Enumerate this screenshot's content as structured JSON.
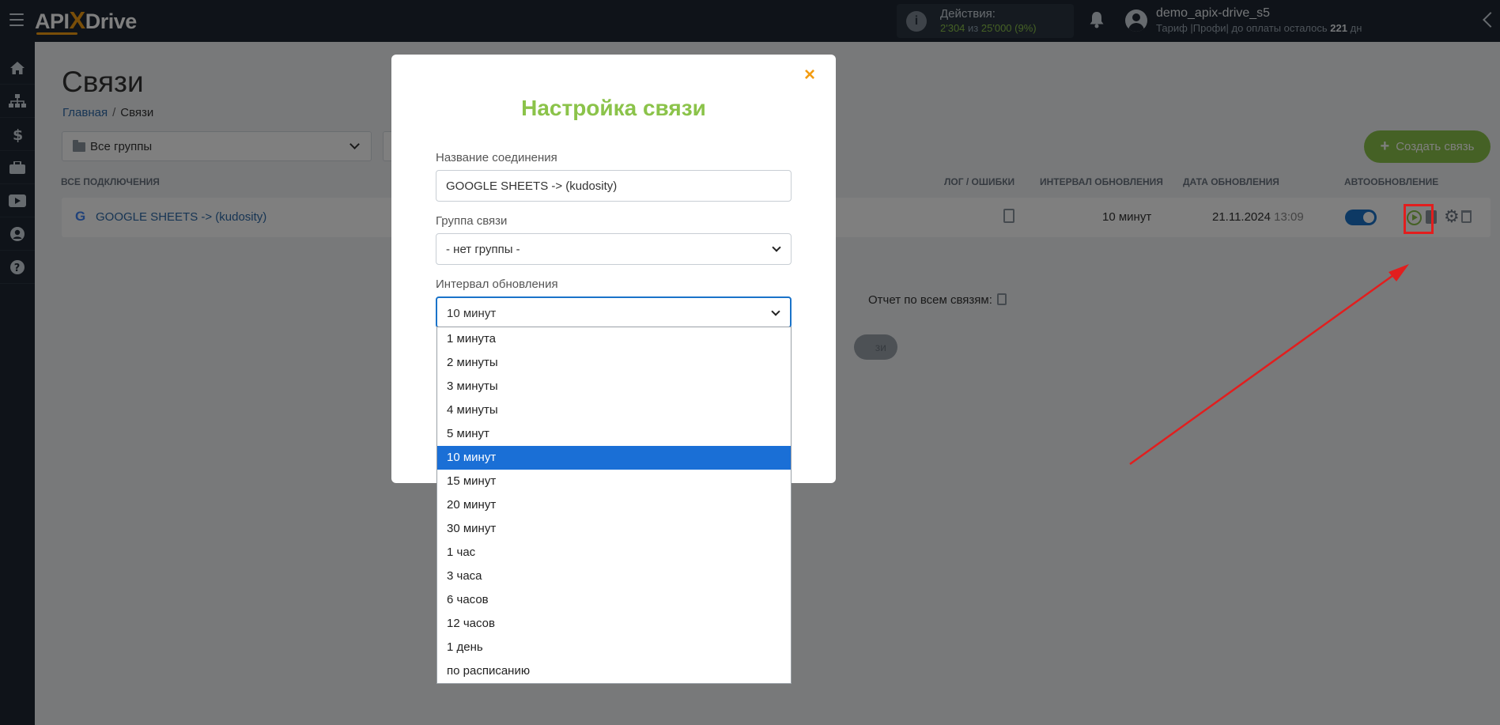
{
  "topbar": {
    "logo_prefix": "API",
    "logo_x": "X",
    "logo_suffix": "Drive",
    "actions_label": "Действия:",
    "actions_used": "2'304",
    "actions_of": "из",
    "actions_total": "25'000",
    "actions_percent": "(9%)",
    "user_name": "demo_apix-drive_s5",
    "plan_text": "Тариф |Профи| до оплаты осталось",
    "plan_days": "221",
    "plan_days_unit": "дн"
  },
  "sidebar": {
    "icons": [
      "home-icon",
      "sitemap-icon",
      "dollar-icon",
      "briefcase-icon",
      "video-icon",
      "user-icon",
      "help-icon"
    ]
  },
  "page": {
    "title": "Связи",
    "breadcrumb_home": "Главная",
    "breadcrumb_sep": "/",
    "breadcrumb_current": "Связи",
    "group_filter": "Все группы",
    "create_button": "Создать связь"
  },
  "table": {
    "headers": {
      "all_connections": "ВСЕ ПОДКЛЮЧЕНИЯ",
      "log": "ЛОГ / ОШИБКИ",
      "interval": "ИНТЕРВАЛ ОБНОВЛЕНИЯ",
      "date": "ДАТА ОБНОВЛЕНИЯ",
      "auto": "АВТООБНОВЛЕНИЕ"
    },
    "rows": [
      {
        "source_icon": "G",
        "name": "GOOGLE SHEETS -> (kudosity)",
        "interval": "10 минут",
        "date": "21.11.2024",
        "time": "13:09",
        "auto_update": true
      }
    ]
  },
  "report": {
    "label": "Отчет по всем связям:"
  },
  "hidden_pill_text": "зи",
  "modal": {
    "close": "×",
    "title": "Настройка связи",
    "name_label": "Название соединения",
    "name_value": "GOOGLE SHEETS -> (kudosity)",
    "group_label": "Группа связи",
    "group_value": "- нет группы -",
    "interval_label": "Интервал обновления",
    "interval_value": "10 минут"
  },
  "interval_options": [
    "1 минута",
    "2 минуты",
    "3 минуты",
    "4 минуты",
    "5 минут",
    "10 минут",
    "15 минут",
    "20 минут",
    "30 минут",
    "1 час",
    "3 часа",
    "6 часов",
    "12 часов",
    "1 день",
    "по расписанию"
  ],
  "selected_interval_index": 5,
  "colors": {
    "accent_green": "#8bc34a",
    "accent_orange": "#f39c12",
    "selected_blue": "#1a6fd6",
    "annotation_red": "#e21e1e"
  }
}
